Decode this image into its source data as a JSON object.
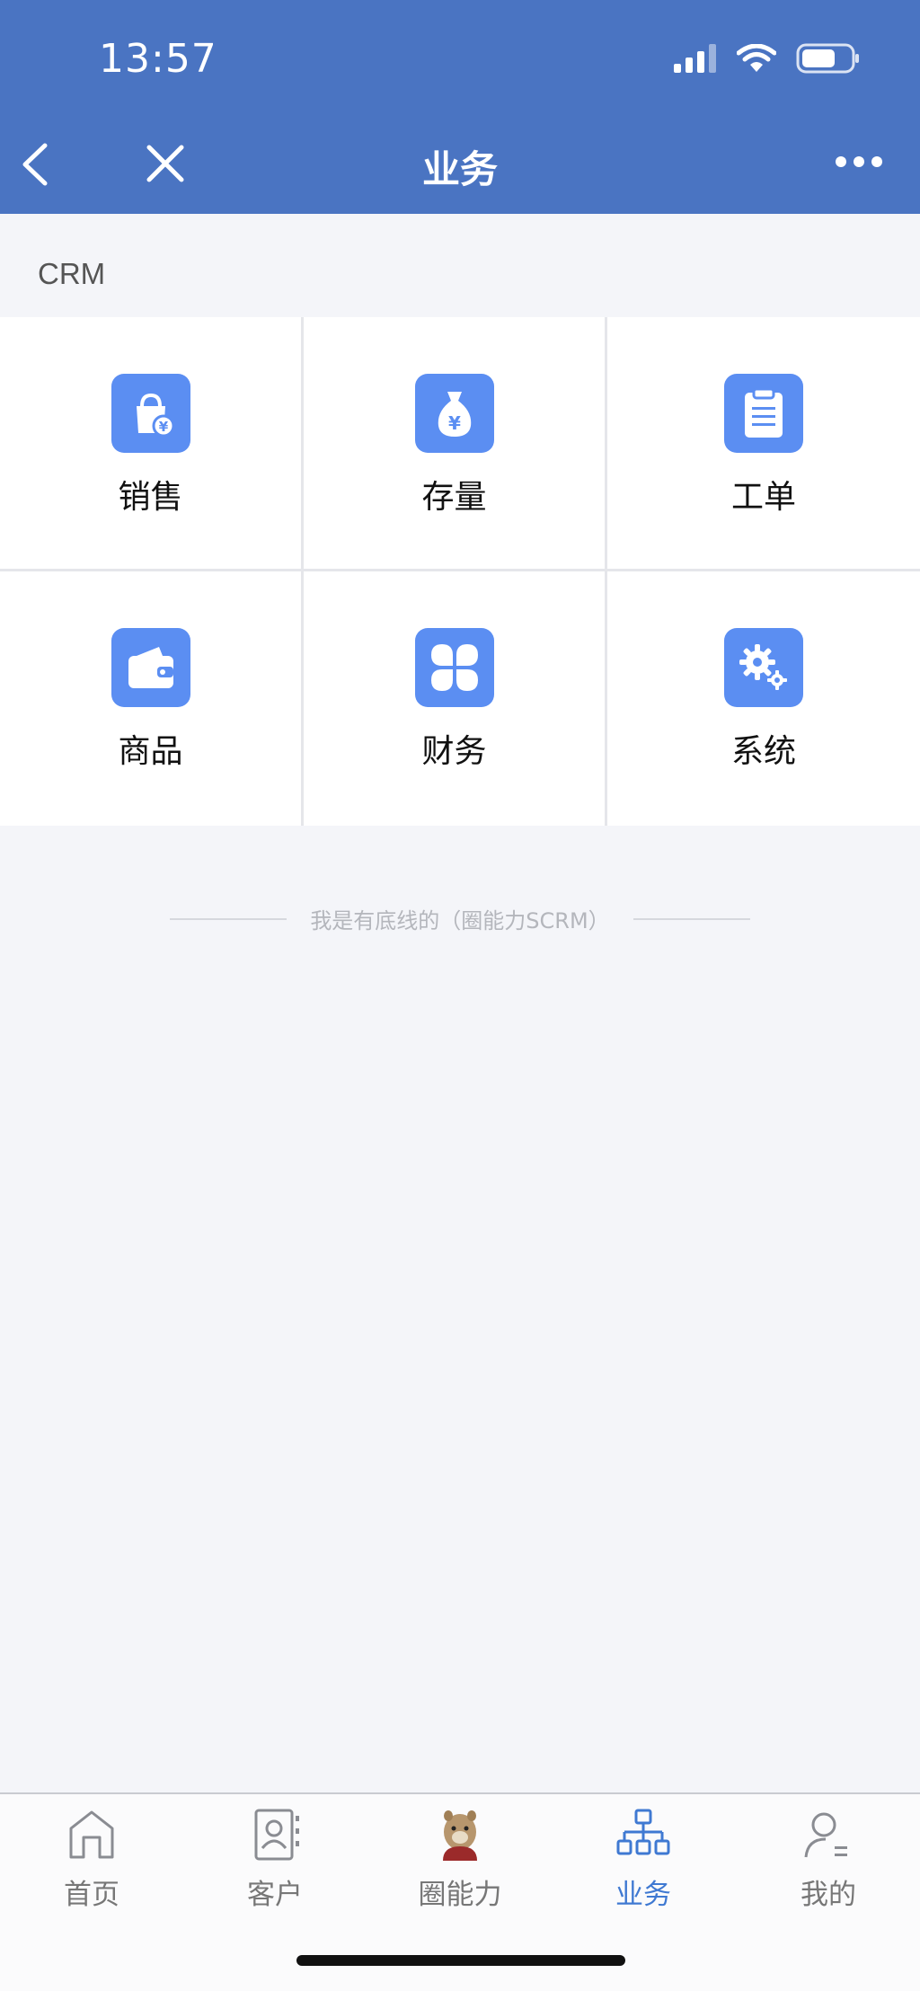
{
  "status": {
    "time": "13:57"
  },
  "nav": {
    "title": "业务"
  },
  "section": {
    "title": "CRM"
  },
  "modules": [
    {
      "label": "销售",
      "icon": "shopping-bag-yen-icon"
    },
    {
      "label": "存量",
      "icon": "money-bag-icon"
    },
    {
      "label": "工单",
      "icon": "clipboard-icon"
    },
    {
      "label": "商品",
      "icon": "wallet-icon"
    },
    {
      "label": "财务",
      "icon": "clover-icon"
    },
    {
      "label": "系统",
      "icon": "gear-icon"
    }
  ],
  "footer": {
    "text": "我是有底线的（圈能力SCRM）"
  },
  "tabs": [
    {
      "label": "首页",
      "icon": "home-icon"
    },
    {
      "label": "客户",
      "icon": "contacts-icon"
    },
    {
      "label": "圈能力",
      "icon": "mascot-icon"
    },
    {
      "label": "业务",
      "icon": "org-chart-icon",
      "active": true
    },
    {
      "label": "我的",
      "icon": "user-icon"
    }
  ],
  "colors": {
    "primary": "#4a74c2",
    "icon_bg": "#5b8ef2",
    "active_tab": "#3f79d2"
  }
}
